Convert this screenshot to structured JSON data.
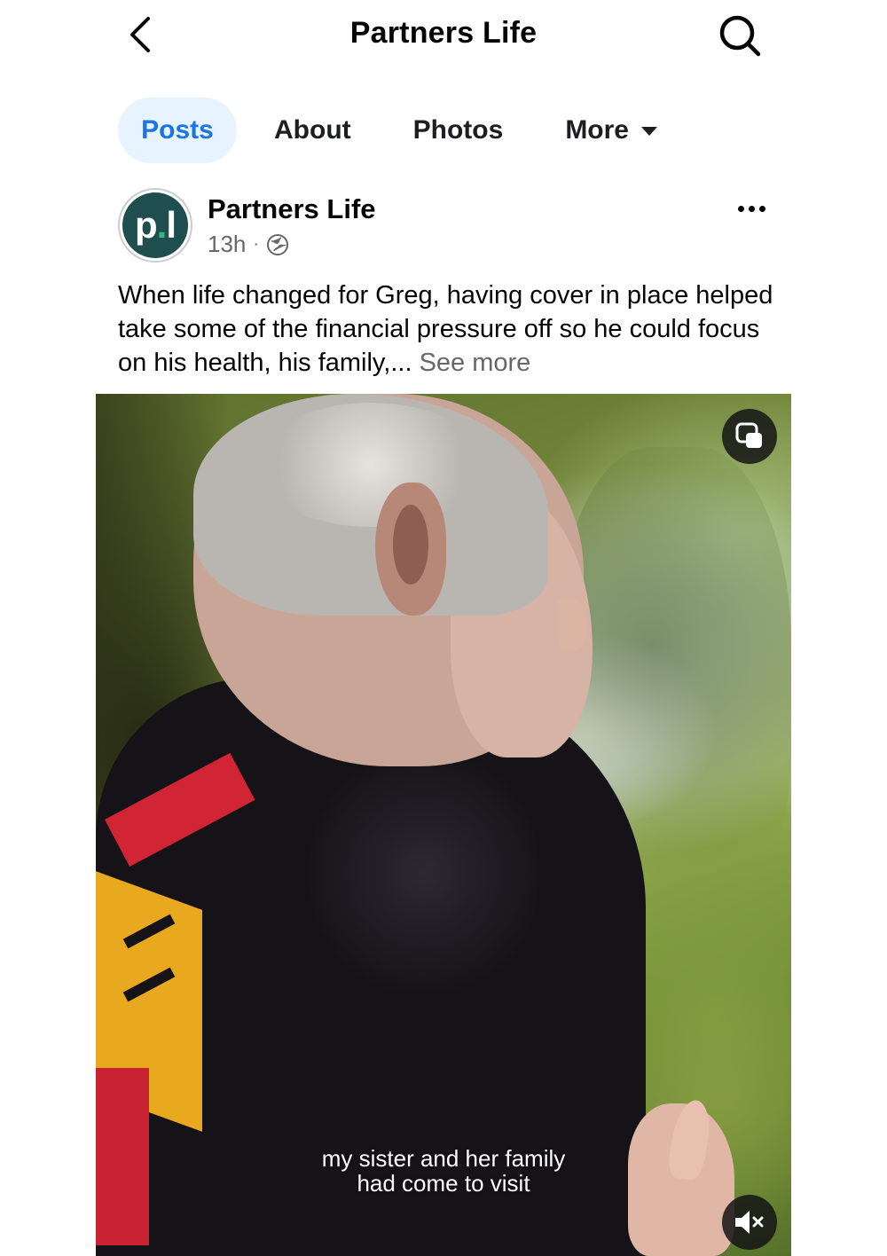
{
  "header": {
    "title": "Partners Life",
    "back_icon": "chevron-left-icon",
    "search_icon": "search-icon"
  },
  "tabs": [
    {
      "label": "Posts",
      "active": true
    },
    {
      "label": "About",
      "active": false
    },
    {
      "label": "Photos",
      "active": false
    },
    {
      "label": "More",
      "active": false,
      "icon": "caret-down-icon"
    }
  ],
  "post": {
    "avatar_text": "p.l",
    "avatar_letter_p": "p",
    "avatar_dot": ".",
    "avatar_letter_l": "l",
    "author": "Partners Life",
    "time": "13h",
    "separator": "·",
    "audience_icon": "globe-icon",
    "options_icon": "more-dots-icon",
    "caption": "When life changed for Greg, having cover in place helped take some of the financial pressure off so he could focus on his health, his family,...",
    "see_more": "See more"
  },
  "video": {
    "subtitle_line1": "my sister and her family",
    "subtitle_line2": "had come to visit",
    "pip_icon": "picture-in-picture-icon",
    "mute_icon": "speaker-muted-icon"
  },
  "colors": {
    "accent": "#1b74e4",
    "active_tab_bg": "#e7f3ff",
    "secondary_text": "#65676b",
    "avatar_bg": "#1f4e4e",
    "avatar_dot": "#3fb37f"
  }
}
